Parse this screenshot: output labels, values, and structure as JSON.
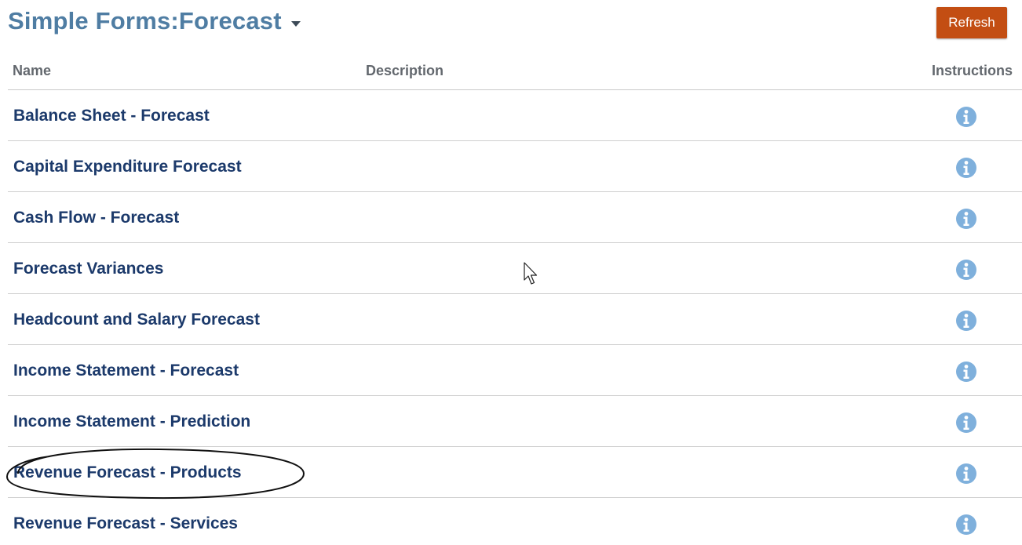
{
  "header": {
    "title": "Simple Forms:Forecast",
    "title_menu_icon": "caret-down-icon"
  },
  "toolbar": {
    "refresh_label": "Refresh"
  },
  "table": {
    "columns": [
      "Name",
      "Description",
      "Instructions"
    ],
    "rows": [
      {
        "name": "Balance Sheet - Forecast",
        "description": "",
        "instructions_icon": "info-icon"
      },
      {
        "name": "Capital Expenditure Forecast",
        "description": "",
        "instructions_icon": "info-icon"
      },
      {
        "name": "Cash Flow - Forecast",
        "description": "",
        "instructions_icon": "info-icon"
      },
      {
        "name": "Forecast Variances",
        "description": "",
        "instructions_icon": "info-icon"
      },
      {
        "name": "Headcount and Salary Forecast",
        "description": "",
        "instructions_icon": "info-icon"
      },
      {
        "name": "Income Statement - Forecast",
        "description": "",
        "instructions_icon": "info-icon"
      },
      {
        "name": "Income Statement - Prediction",
        "description": "",
        "instructions_icon": "info-icon"
      },
      {
        "name": "Revenue Forecast - Products",
        "description": "",
        "instructions_icon": "info-icon",
        "annotated": true
      },
      {
        "name": "Revenue Forecast - Services",
        "description": "",
        "instructions_icon": "info-icon"
      }
    ]
  },
  "colors": {
    "title": "#4f7da3",
    "refresh_button": "#c34e13",
    "row_link": "#1c3a6b",
    "info_icon": "#7fb0dc",
    "header_text": "#63686e"
  }
}
